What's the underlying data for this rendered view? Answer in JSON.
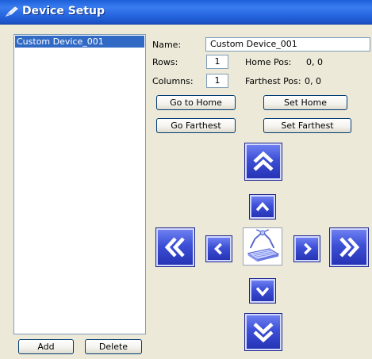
{
  "window": {
    "title": "Device Setup",
    "title_icon": "pencil-icon"
  },
  "device_list": {
    "items": [
      "Custom Device_001"
    ],
    "selected_index": 0,
    "add_label": "Add",
    "delete_label": "Delete"
  },
  "properties": {
    "name_label": "Name:",
    "name_value": "Custom Device_001",
    "rows_label": "Rows:",
    "rows_value": "1",
    "columns_label": "Columns:",
    "columns_value": "1",
    "home_pos_label": "Home Pos:",
    "home_pos_value": "0, 0",
    "farthest_pos_label": "Farthest Pos:",
    "farthest_pos_value": "0, 0"
  },
  "actions": {
    "go_home_label": "Go to Home",
    "set_home_label": "Set Home",
    "go_farthest_label": "Go Farthest",
    "set_farthest_label": "Set Farthest"
  },
  "navigation": {
    "up_fast_icon": "double-chevron-up-icon",
    "up_icon": "chevron-up-icon",
    "down_icon": "chevron-down-icon",
    "down_fast_icon": "double-chevron-down-icon",
    "left_fast_icon": "double-chevron-left-icon",
    "left_icon": "chevron-left-icon",
    "right_icon": "chevron-right-icon",
    "right_fast_icon": "double-chevron-right-icon",
    "center_icon": "robot-gripper-plate-icon"
  },
  "colors": {
    "title_bar": "#2463dc",
    "selection": "#316ac5",
    "nav_button": "#3c4fd6",
    "window_bg": "#ece9d8"
  }
}
